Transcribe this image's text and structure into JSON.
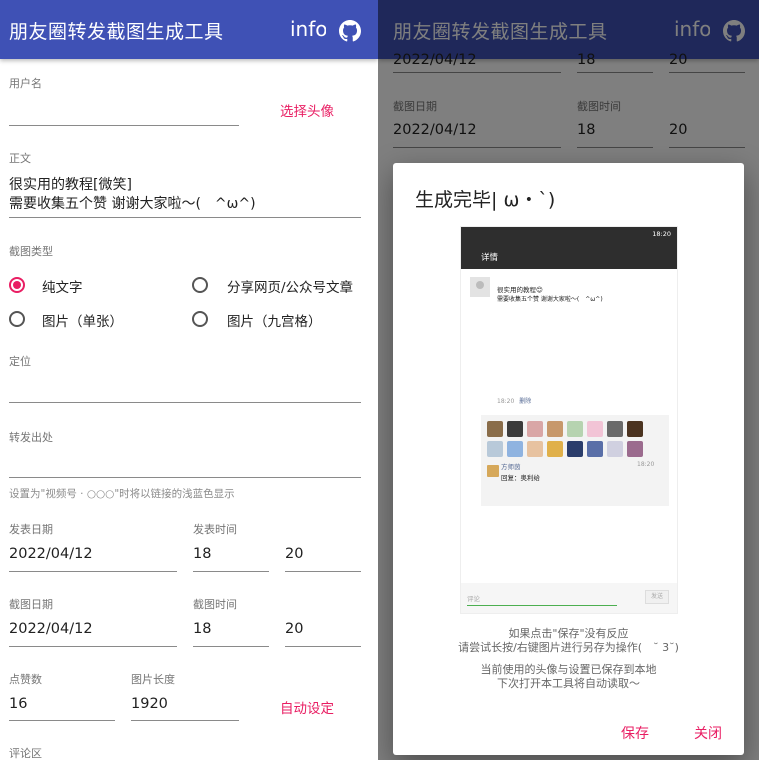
{
  "app": {
    "title": "朋友圈转发截图生成工具",
    "info_label": "info"
  },
  "form": {
    "username_label": "用户名",
    "choose_avatar": "选择头像",
    "body_label": "正文",
    "body_line1": "很实用的教程[微笑]",
    "body_line2": "需要收集五个赞 谢谢大家啦～(　^ω^)",
    "type_label": "截图类型",
    "types": [
      {
        "label": "纯文字",
        "selected": true
      },
      {
        "label": "分享网页/公众号文章",
        "selected": false
      },
      {
        "label": "图片（单张）",
        "selected": false
      },
      {
        "label": "图片（九宫格）",
        "selected": false
      }
    ],
    "location_label": "定位",
    "forward_label": "转发出处",
    "forward_hint": "设置为\"视频号 · ○○○\"时将以链接的浅蓝色显示",
    "post_date_label": "发表日期",
    "post_date": "2022/04/12",
    "post_time_label": "发表时间",
    "post_hour": "18",
    "post_minute": "20",
    "shot_date_label": "截图日期",
    "shot_date": "2022/04/12",
    "shot_time_label": "截图时间",
    "shot_hour": "18",
    "shot_minute": "20",
    "likes_label": "点赞数",
    "likes": "16",
    "img_len_label": "图片长度",
    "img_len": "1920",
    "auto_set": "自动设定",
    "comments_label": "评论区"
  },
  "right_bg": {
    "top_date": "2022/04/12",
    "top_hour": "18",
    "top_minute": "20"
  },
  "dialog": {
    "title": "生成完毕| ω・`)",
    "note1": "如果点击\"保存\"没有反应",
    "note2": "请尝试长按/右键图片进行另存为操作(　˘ 3˘)",
    "note3": "当前使用的头像与设置已保存到本地",
    "note4": "下次打开本工具将自动读取～",
    "save": "保存",
    "close": "关闭"
  },
  "preview": {
    "status_time": "18:20",
    "header_title": "详情",
    "post_line1": "很实用的教程😊",
    "post_line2": "需要收集五个赞 谢谢大家啦～(　^ω^)",
    "post_time": "18:20",
    "delete": "删除",
    "comment_name": "方师茵",
    "comment_time": "18:20",
    "comment_text": "回复：奥利给",
    "comment_placeholder": "评论",
    "send": "发送"
  },
  "colors": {
    "primary": "#3f51b5",
    "accent": "#e91e63"
  }
}
